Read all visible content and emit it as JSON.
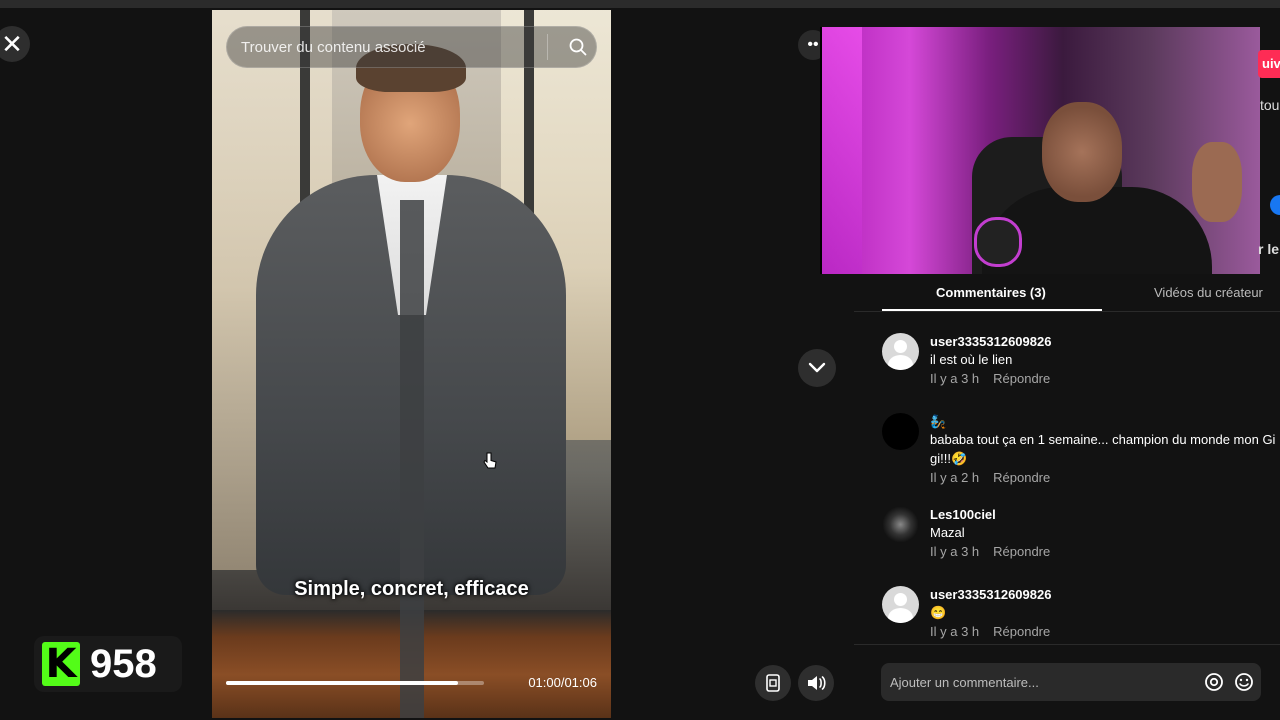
{
  "viewer": {
    "close_icon": "close-icon",
    "search": {
      "placeholder": "Trouver du contenu associé",
      "icon": "search-icon"
    },
    "subtitle": "Simple, concret, efficace",
    "progress": 0.9,
    "time": "01:00/01:06"
  },
  "kick": {
    "logo": "K",
    "count": "958",
    "color": "#53fc18"
  },
  "side_partial": {
    "follow": "uiv",
    "line1": "tou",
    "line2": "r le"
  },
  "tabs": {
    "comments": "Commentaires (3)",
    "creator": "Vidéos du créateur"
  },
  "comments": [
    {
      "user": "user3335312609826",
      "text": "il est où le lien",
      "time": "Il y a 3 h",
      "reply": "Répondre"
    },
    {
      "user": "🧞",
      "text": "bababa tout ça en 1 semaine... champion du monde mon Gi gi!!!🤣",
      "time": "Il y a 2 h",
      "reply": "Répondre"
    },
    {
      "user": "Les100ciel",
      "text": "Mazal",
      "time": "Il y a 3 h",
      "reply": "Répondre"
    },
    {
      "user": "user3335312609826",
      "text": "😁",
      "time": "Il y a 3 h",
      "reply": "Répondre"
    }
  ],
  "comment_input": {
    "placeholder": "Ajouter un commentaire...",
    "mention_icon": "at-icon",
    "emoji_icon": "emoji-icon"
  },
  "colors": {
    "accent": "#fe2c55",
    "background": "#121212"
  }
}
